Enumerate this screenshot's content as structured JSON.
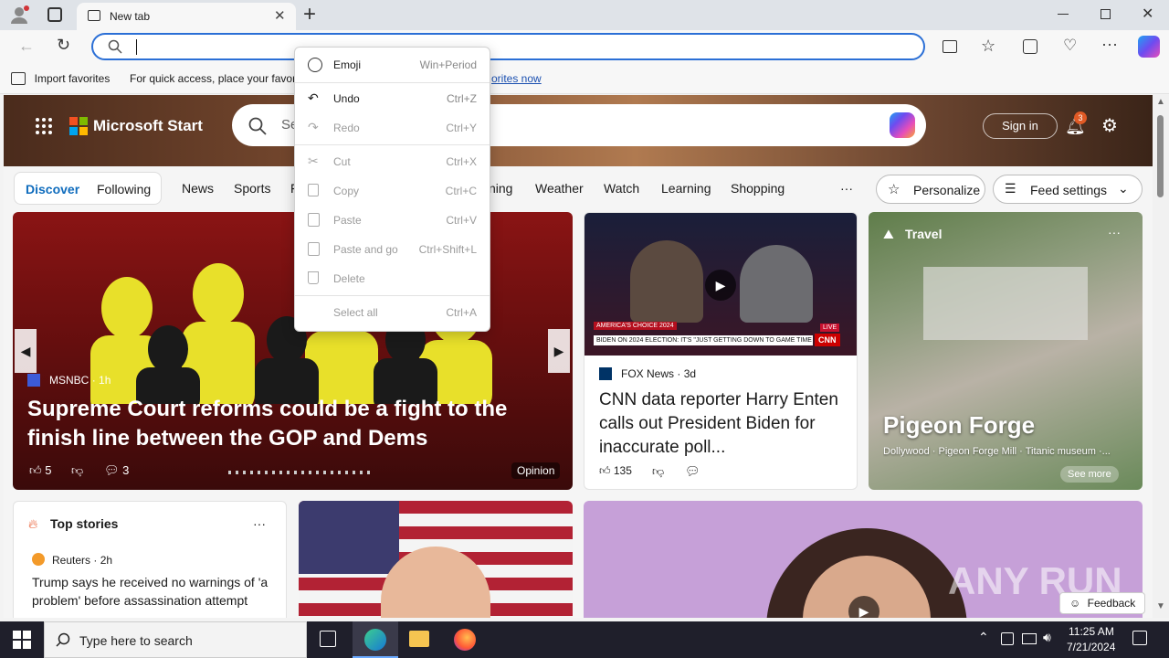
{
  "browser": {
    "tab_title": "New tab",
    "favorites_bar": {
      "import_label": "Import favorites",
      "hint_text": "For quick access, place your favori",
      "hint_link": "orites now"
    }
  },
  "context_menu": {
    "items": [
      {
        "label": "Emoji",
        "shortcut": "Win+Period",
        "enabled": true
      },
      {
        "label": "Undo",
        "shortcut": "Ctrl+Z",
        "enabled": true
      },
      {
        "label": "Redo",
        "shortcut": "Ctrl+Y",
        "enabled": false
      },
      {
        "label": "Cut",
        "shortcut": "Ctrl+X",
        "enabled": false
      },
      {
        "label": "Copy",
        "shortcut": "Ctrl+C",
        "enabled": false
      },
      {
        "label": "Paste",
        "shortcut": "Ctrl+V",
        "enabled": false
      },
      {
        "label": "Paste and go",
        "shortcut": "Ctrl+Shift+L",
        "enabled": false
      },
      {
        "label": "Delete",
        "shortcut": "",
        "enabled": false
      },
      {
        "label": "Select all",
        "shortcut": "Ctrl+A",
        "enabled": false
      }
    ]
  },
  "msstart": {
    "brand": "Microsoft Start",
    "search_placeholder": "Se",
    "sign_in": "Sign in",
    "notif_count": "3",
    "nav": {
      "discover": "Discover",
      "following": "Following",
      "items": [
        "News",
        "Sports",
        "F",
        "ning",
        "Weather",
        "Watch",
        "Learning",
        "Shopping"
      ],
      "more": "···",
      "personalize": "Personalize",
      "feed_settings": "Feed settings"
    },
    "hero_card": {
      "source": "MSNBC",
      "time": "· 1h",
      "headline": "Supreme Court reforms could be a fight to the finish line between the GOP and Dems",
      "likes": "5",
      "comments": "3",
      "tag": "Opinion"
    },
    "news_card": {
      "source": "FOX News",
      "time": "· 3d",
      "headline": "CNN data reporter Harry Enten calls out President Biden for inaccurate poll...",
      "likes": "135",
      "ticker": "BIDEN ON 2024 ELECTION: IT'S \"JUST GETTING DOWN TO GAME TIME NOW\"",
      "banner": "AMERICA'S CHOICE 2024",
      "live": "LIVE",
      "cnn": "CNN"
    },
    "travel_card": {
      "category": "Travel",
      "title": "Pigeon Forge",
      "subtitle": "Dollywood · Pigeon Forge Mill · Titanic museum ·...",
      "see_more": "See more",
      "more_icon": "···"
    },
    "top_stories": {
      "title": "Top stories",
      "more": "···",
      "source": "Reuters",
      "time": "· 2h",
      "headline": "Trump says he received no warnings of 'a problem' before assassination attempt"
    },
    "feedback": "Feedback",
    "watermark": "ANY RUN"
  },
  "taskbar": {
    "search_placeholder": "Type here to search",
    "time": "11:25 AM",
    "date": "7/21/2024"
  }
}
